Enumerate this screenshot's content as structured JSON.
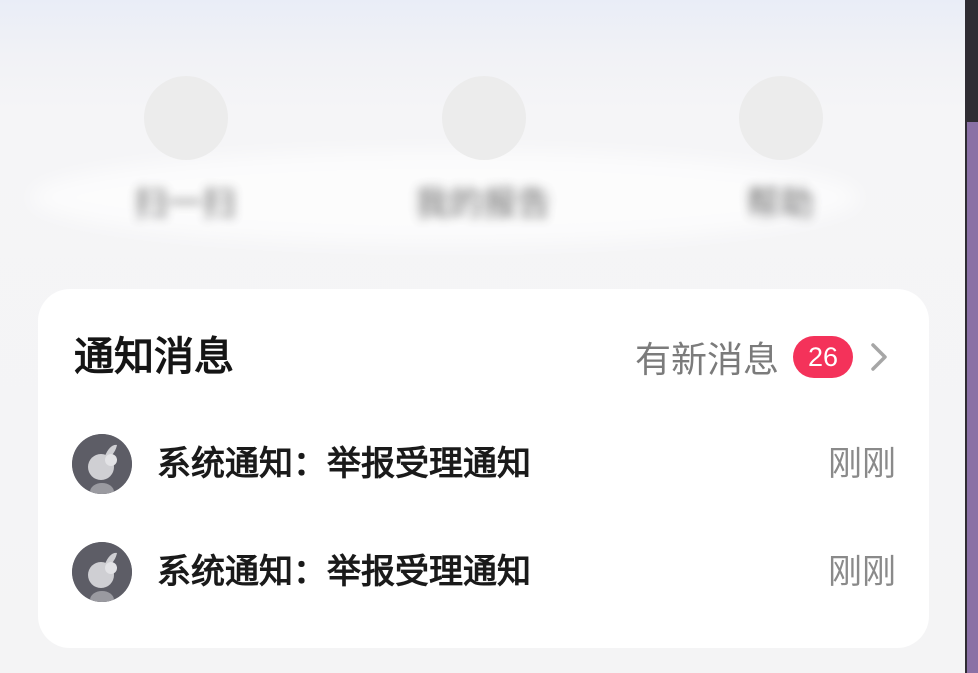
{
  "shortcuts": [
    {
      "label": "扫一扫",
      "icon": "scan-icon"
    },
    {
      "label": "我的报告",
      "icon": "report-icon"
    },
    {
      "label": "帮助",
      "icon": "help-icon"
    }
  ],
  "notifications": {
    "title": "通知消息",
    "more_label": "有新消息",
    "badge_count": "26",
    "badge_color": "#f4325a",
    "items": [
      {
        "text": "系统通知：举报受理通知",
        "time": "刚刚",
        "icon": "system-avatar-icon"
      },
      {
        "text": "系统通知：举报受理通知",
        "time": "刚刚",
        "icon": "system-avatar-icon"
      }
    ]
  },
  "colors": {
    "scrollbar_thumb": "#8a70a5",
    "card_background": "#ffffff"
  }
}
